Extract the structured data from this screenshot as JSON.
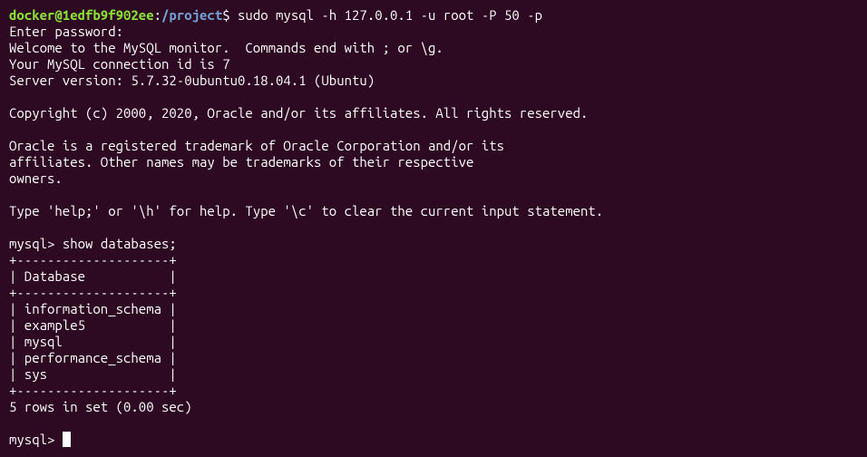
{
  "prompt1": {
    "user_host": "docker@1edfb9f902ee",
    "separator": ":",
    "path": "/project",
    "dollar": "$ ",
    "command": "sudo mysql -h 127.0.0.1 -u root -P 50 -p"
  },
  "lines": {
    "enter_password": "Enter password:",
    "welcome": "Welcome to the MySQL monitor.  Commands end with ; or \\g.",
    "conn_id": "Your MySQL connection id is 7",
    "server_version": "Server version: 5.7.32-0ubuntu0.18.04.1 (Ubuntu)",
    "blank1": "",
    "copyright": "Copyright (c) 2000, 2020, Oracle and/or its affiliates. All rights reserved.",
    "blank2": "",
    "trademark1": "Oracle is a registered trademark of Oracle Corporation and/or its",
    "trademark2": "affiliates. Other names may be trademarks of their respective",
    "trademark3": "owners.",
    "blank3": "",
    "help": "Type 'help;' or '\\h' for help. Type '\\c' to clear the current input statement.",
    "blank4": "",
    "mysql_prompt1": "mysql> ",
    "show_db_cmd": "show databases;",
    "table_top": "+--------------------+",
    "table_header": "| Database           |",
    "table_sep": "+--------------------+",
    "row1": "| information_schema |",
    "row2": "| example5           |",
    "row3": "| mysql              |",
    "row4": "| performance_schema |",
    "row5": "| sys                |",
    "table_bottom": "+--------------------+",
    "rows_result": "5 rows in set (0.00 sec)",
    "blank5": "",
    "mysql_prompt2": "mysql> "
  },
  "databases": [
    "information_schema",
    "example5",
    "mysql",
    "performance_schema",
    "sys"
  ]
}
